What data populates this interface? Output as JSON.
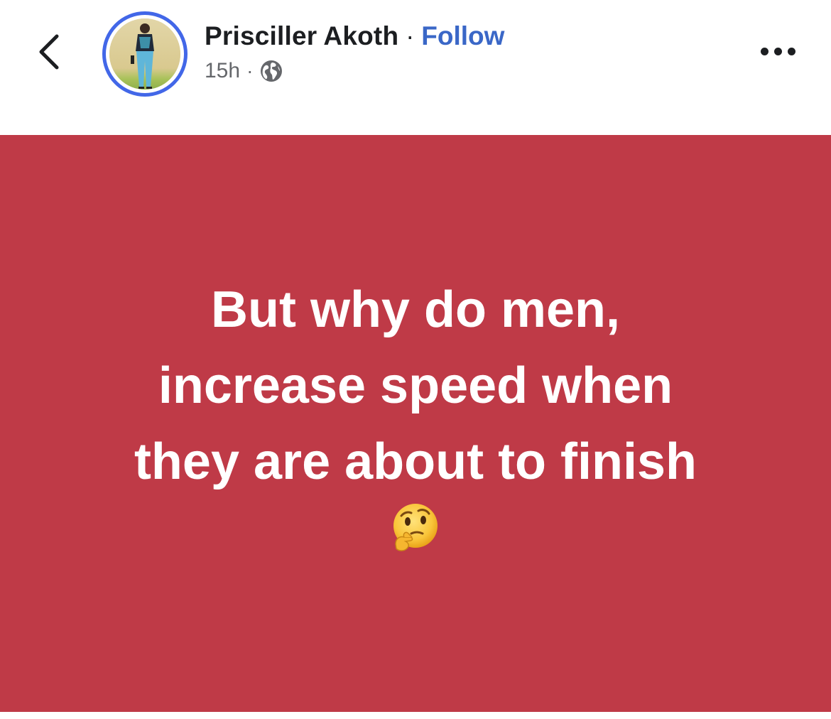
{
  "header": {
    "author_name": "Prisciller Akoth",
    "separator": "·",
    "follow_label": "Follow",
    "timestamp": "15h",
    "meta_separator": "·",
    "audience_icon": "globe-icon",
    "back_icon": "chevron-left-icon",
    "more_icon": "more-horizontal-icon"
  },
  "post": {
    "lines": [
      "But why do men,",
      "increase speed when",
      "they are about to finish"
    ],
    "emoji_icon": "thinking-face-emoji",
    "background_color": "#bf3a47",
    "text_color": "#ffffff"
  },
  "colors": {
    "follow_blue": "#3a67c7",
    "avatar_ring": "#4267e8",
    "meta_gray": "#65676b"
  }
}
